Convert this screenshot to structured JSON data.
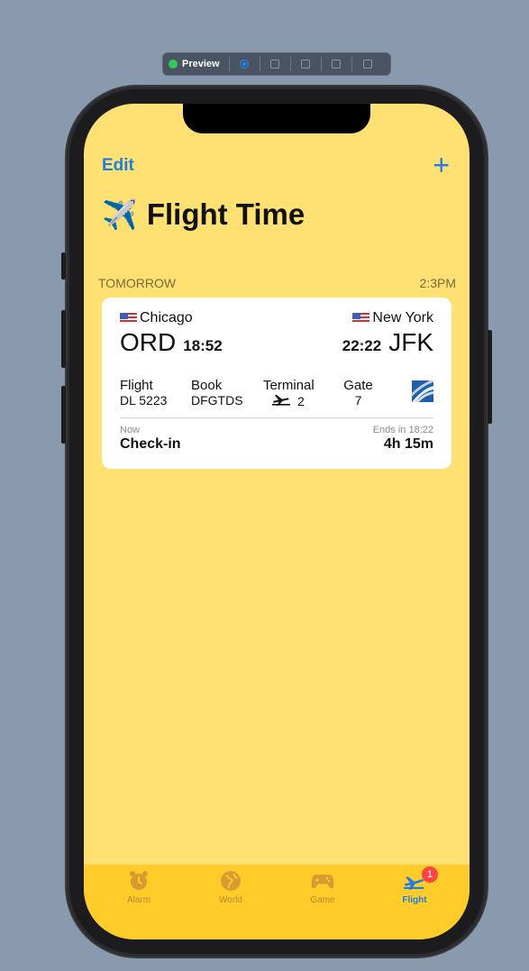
{
  "preview": {
    "label": "Preview"
  },
  "nav": {
    "edit_label": "Edit",
    "add_label": "+"
  },
  "title": {
    "icon": "✈️",
    "text": "Flight Time"
  },
  "section": {
    "heading": "TOMORROW",
    "time": "2:3PM"
  },
  "flight": {
    "from": {
      "city": "Chicago",
      "code": "ORD",
      "time": "18:52"
    },
    "to": {
      "city": "New York",
      "code": "JFK",
      "time": "22:22"
    },
    "details": {
      "flight_label": "Flight",
      "flight_value": "DL 5223",
      "book_label": "Book",
      "book_value": "DFGTDS",
      "terminal_label": "Terminal",
      "terminal_value": "2",
      "gate_label": "Gate",
      "gate_value": "7"
    },
    "status": {
      "now_label": "Now",
      "now_value": "Check-in",
      "ends_label": "Ends in 18:22",
      "ends_value": "4h 15m"
    }
  },
  "tabs": [
    {
      "label": "Alarm",
      "icon": "alarm-clock-icon"
    },
    {
      "label": "World",
      "icon": "globe-icon"
    },
    {
      "label": "Game",
      "icon": "gamepad-icon"
    },
    {
      "label": "Flight",
      "icon": "airplane-icon",
      "badge": "1",
      "active": true
    }
  ],
  "colors": {
    "background": "#ffe073",
    "tabbar": "#ffcc2a",
    "accent": "#1e7fe0",
    "tab_inactive": "#b7893a"
  }
}
